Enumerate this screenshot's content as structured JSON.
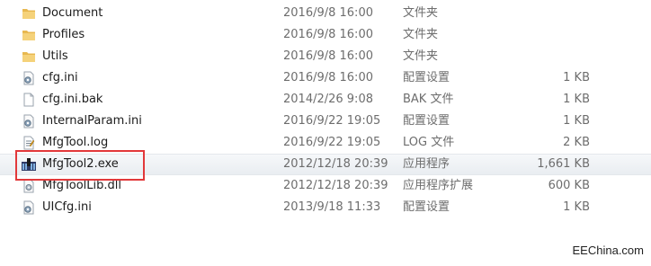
{
  "files": [
    {
      "name": "Document",
      "date": "2016/9/8 16:00",
      "type": "文件夹",
      "size": "",
      "icon": "folder-icon"
    },
    {
      "name": "Profiles",
      "date": "2016/9/8 16:00",
      "type": "文件夹",
      "size": "",
      "icon": "folder-icon"
    },
    {
      "name": "Utils",
      "date": "2016/9/8 16:00",
      "type": "文件夹",
      "size": "",
      "icon": "folder-icon"
    },
    {
      "name": "cfg.ini",
      "date": "2016/9/8 16:00",
      "type": "配置设置",
      "size": "1 KB",
      "icon": "settings-file-icon"
    },
    {
      "name": "cfg.ini.bak",
      "date": "2014/2/26 9:08",
      "type": "BAK 文件",
      "size": "1 KB",
      "icon": "blank-file-icon"
    },
    {
      "name": "InternalParam.ini",
      "date": "2016/9/22 19:05",
      "type": "配置设置",
      "size": "1 KB",
      "icon": "settings-file-icon"
    },
    {
      "name": "MfgTool.log",
      "date": "2016/9/22 19:05",
      "type": "LOG 文件",
      "size": "2 KB",
      "icon": "log-file-icon"
    },
    {
      "name": "MfgTool2.exe",
      "date": "2012/12/18 20:39",
      "type": "应用程序",
      "size": "1,661 KB",
      "icon": "exe-app-icon"
    },
    {
      "name": "MfgToolLib.dll",
      "date": "2012/12/18 20:39",
      "type": "应用程序扩展",
      "size": "600 KB",
      "icon": "dll-file-icon"
    },
    {
      "name": "UICfg.ini",
      "date": "2013/9/18 11:33",
      "type": "配置设置",
      "size": "1 KB",
      "icon": "settings-file-icon"
    }
  ],
  "highlight_color": "#e2383a",
  "watermark": "EEChina.com"
}
